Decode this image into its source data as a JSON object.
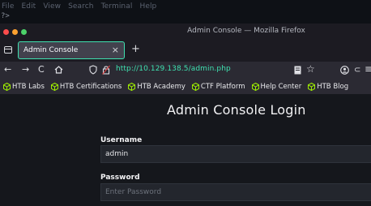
{
  "terminal": {
    "menu": [
      "File",
      "Edit",
      "View",
      "Search",
      "Terminal",
      "Help"
    ],
    "prompt": "?>"
  },
  "window": {
    "title": "Admin Console — Mozilla Firefox",
    "controls": {
      "close_color": "#fc4c4c",
      "min_color": "#fca130",
      "max_color": "#4cd36a"
    }
  },
  "tabs": {
    "active": {
      "title": "Admin Console",
      "close": "×"
    },
    "new_tab": "+"
  },
  "nav": {
    "url": "http://10.129.138.5/admin.php"
  },
  "bookmarks": [
    "HTB Labs",
    "HTB Certifications",
    "HTB Academy",
    "CTF Platform",
    "Help Center",
    "HTB Blog"
  ],
  "page": {
    "title": "Admin Console Login",
    "username_label": "Username",
    "username_value": "admin",
    "password_label": "Password",
    "password_placeholder": "Enter Password"
  },
  "colors": {
    "accent": "#3fe1b0",
    "htb_green": "#9fef00"
  }
}
